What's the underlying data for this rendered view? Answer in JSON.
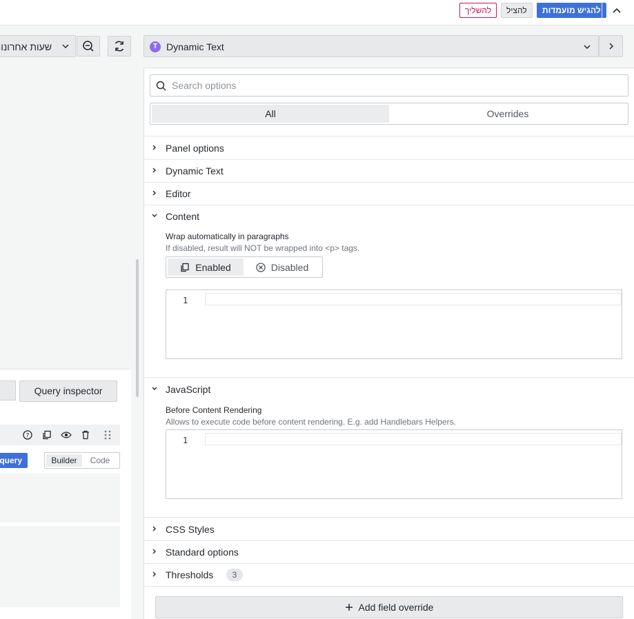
{
  "topbar": {
    "apply_label": "להגיש מועמדות",
    "save_label": "להציל",
    "discard_label": "להשליך"
  },
  "toolbar": {
    "time_range_label": "שעות אחרונות"
  },
  "viz_picker": {
    "label": "Dynamic Text"
  },
  "options": {
    "search_placeholder": "Search options",
    "tabs": [
      "All",
      "Overrides"
    ],
    "sections": {
      "panel_options": "Panel options",
      "dynamic_text": "Dynamic Text",
      "editor": "Editor",
      "content": "Content",
      "javascript": "JavaScript",
      "css_styles": "CSS Styles",
      "standard_options": "Standard options",
      "thresholds": "Thresholds"
    },
    "thresholds_count": "3",
    "content": {
      "wrap_label": "Wrap automatically in paragraphs",
      "wrap_desc": "If disabled, result will NOT be wrapped into <p> tags.",
      "enabled_label": "Enabled",
      "disabled_label": "Disabled",
      "line_number": "1"
    },
    "javascript": {
      "before_label": "Before Content Rendering",
      "before_desc": "Allows to execute code before content rendering. E.g. add Handlebars Helpers.",
      "line_number": "1"
    },
    "add_override_label": "Add field override"
  },
  "query": {
    "inspector_label": "Query inspector",
    "run_query_label": "query",
    "builder_label": "Builder",
    "code_label": "Code"
  }
}
